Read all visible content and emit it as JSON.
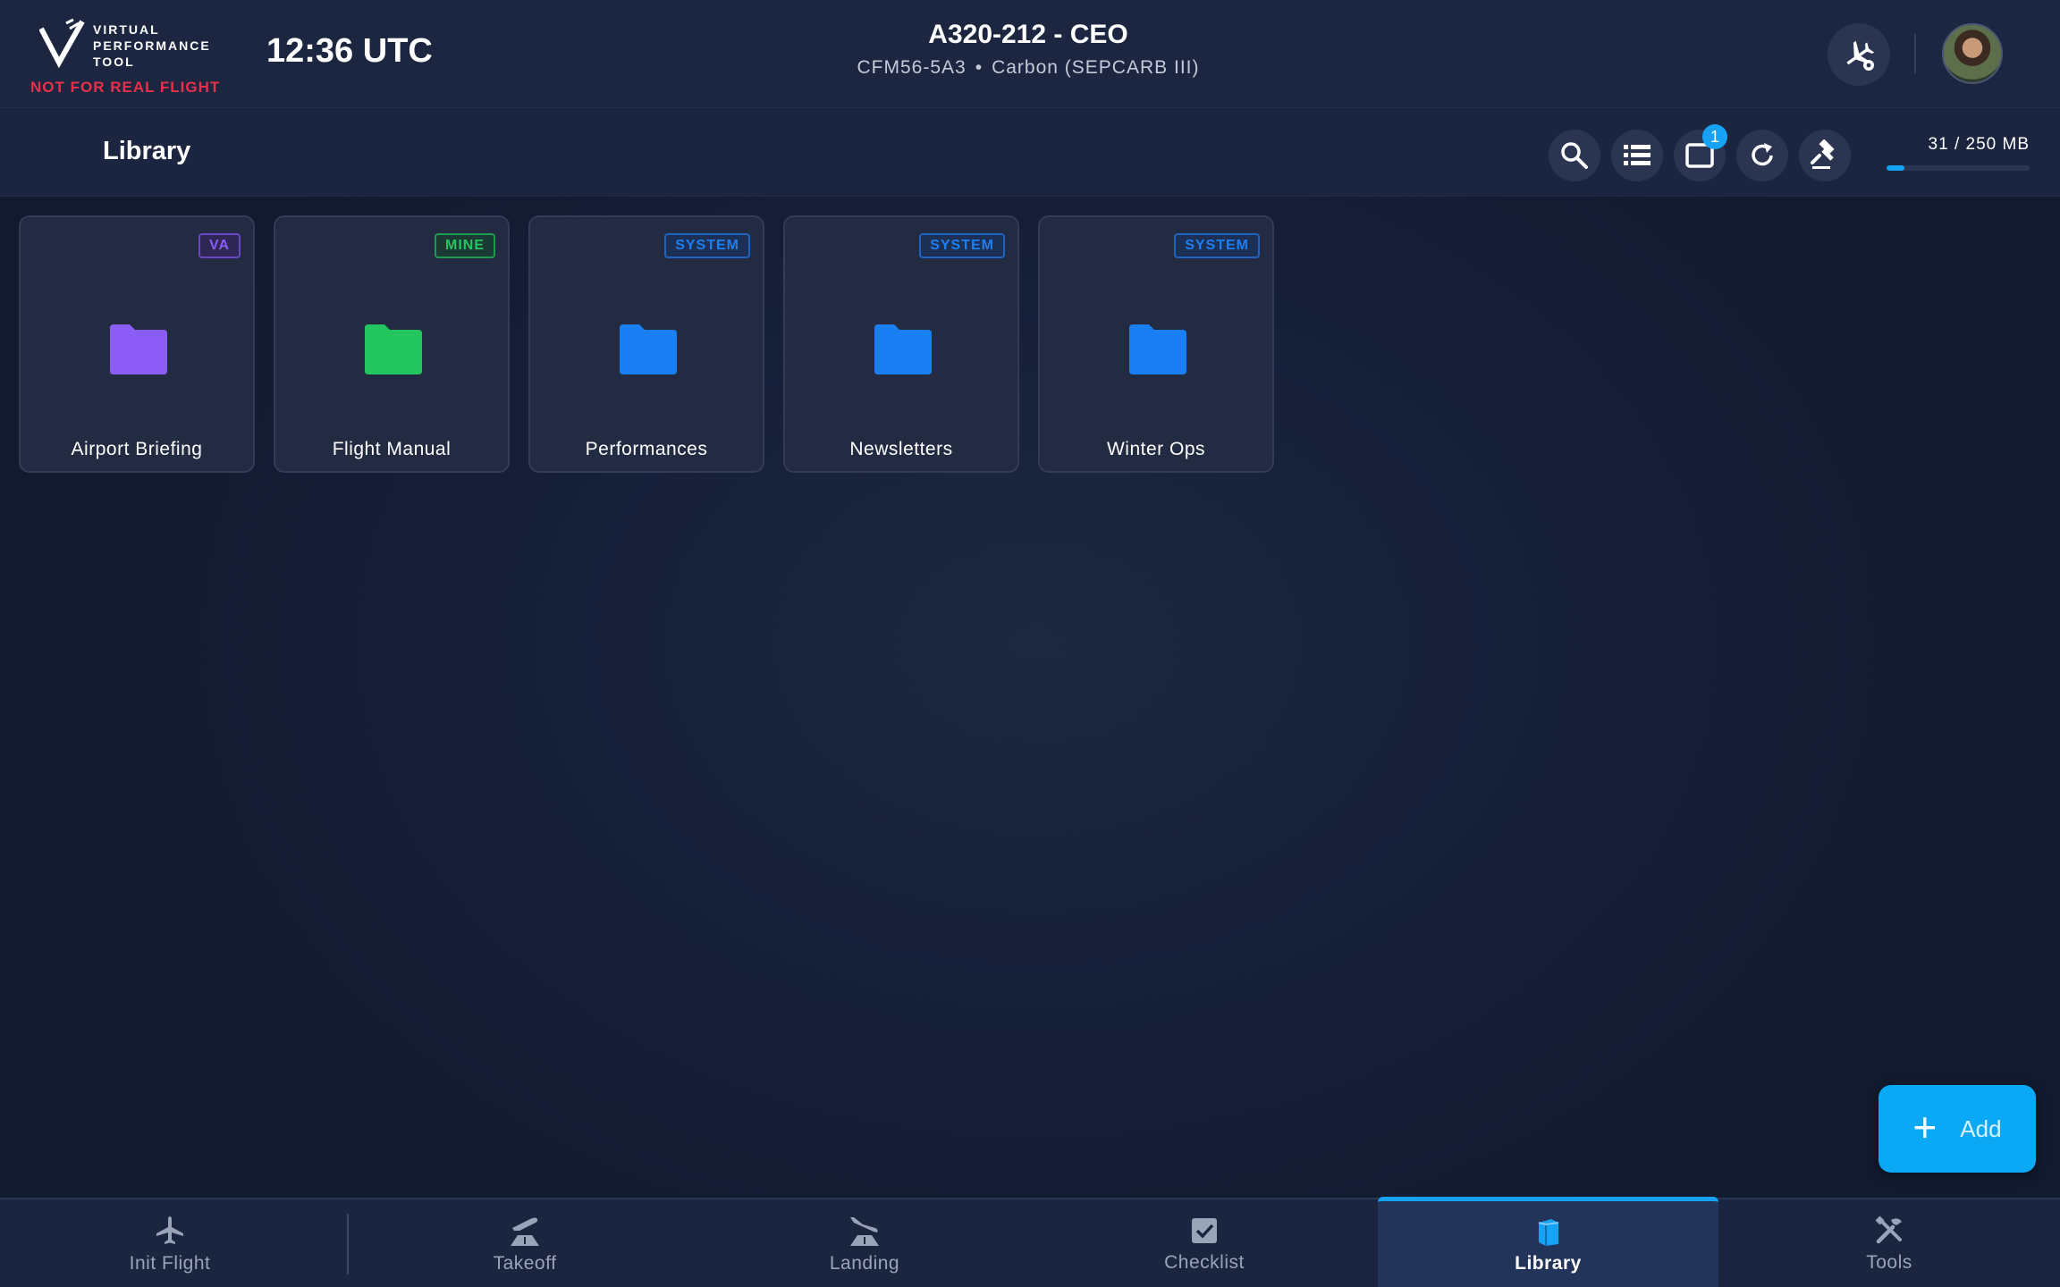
{
  "header": {
    "logo_text": "VIRTUAL\nPERFORMANCE\nTOOL",
    "logo_warning": "NOT FOR REAL FLIGHT",
    "clock": "12:36 UTC",
    "aircraft_title": "A320-212 - CEO",
    "engine": "CFM56-5A3",
    "separator": "•",
    "brakes": "Carbon (SEPCARB III)",
    "aircraft_settings_icon": "plane-gear-icon",
    "avatar_icon": "user-avatar"
  },
  "subheader": {
    "title": "Library",
    "tools": [
      {
        "icon": "search-icon"
      },
      {
        "icon": "list-view-icon"
      },
      {
        "icon": "selection-icon",
        "badge": "1"
      },
      {
        "icon": "refresh-icon"
      },
      {
        "icon": "gavel-icon"
      }
    ],
    "storage": {
      "text": "31 / 250 MB",
      "used_fraction": 0.124
    }
  },
  "folders": [
    {
      "label": "Airport Briefing",
      "tag": "VA",
      "color": "#8b5cf6"
    },
    {
      "label": "Flight Manual",
      "tag": "MINE",
      "color": "#22c55e"
    },
    {
      "label": "Performances",
      "tag": "SYSTEM",
      "color": "#1a7ff2"
    },
    {
      "label": "Newsletters",
      "tag": "SYSTEM",
      "color": "#1a7ff2"
    },
    {
      "label": "Winter Ops",
      "tag": "SYSTEM",
      "color": "#1a7ff2"
    }
  ],
  "fab": {
    "plus": "+",
    "label": "Add"
  },
  "nav": {
    "items": [
      {
        "label": "Init Flight",
        "icon": "plane-icon"
      },
      {
        "label": "Takeoff",
        "icon": "takeoff-icon"
      },
      {
        "label": "Landing",
        "icon": "landing-icon"
      },
      {
        "label": "Checklist",
        "icon": "checklist-icon"
      },
      {
        "label": "Library",
        "icon": "library-icon",
        "active": true
      },
      {
        "label": "Tools",
        "icon": "tools-icon"
      }
    ]
  },
  "colors": {
    "accent": "#17a3f5",
    "warning": "#e8304a",
    "folder_va": "#8b5cf6",
    "folder_mine": "#22c55e",
    "folder_system": "#1a7ff2"
  }
}
